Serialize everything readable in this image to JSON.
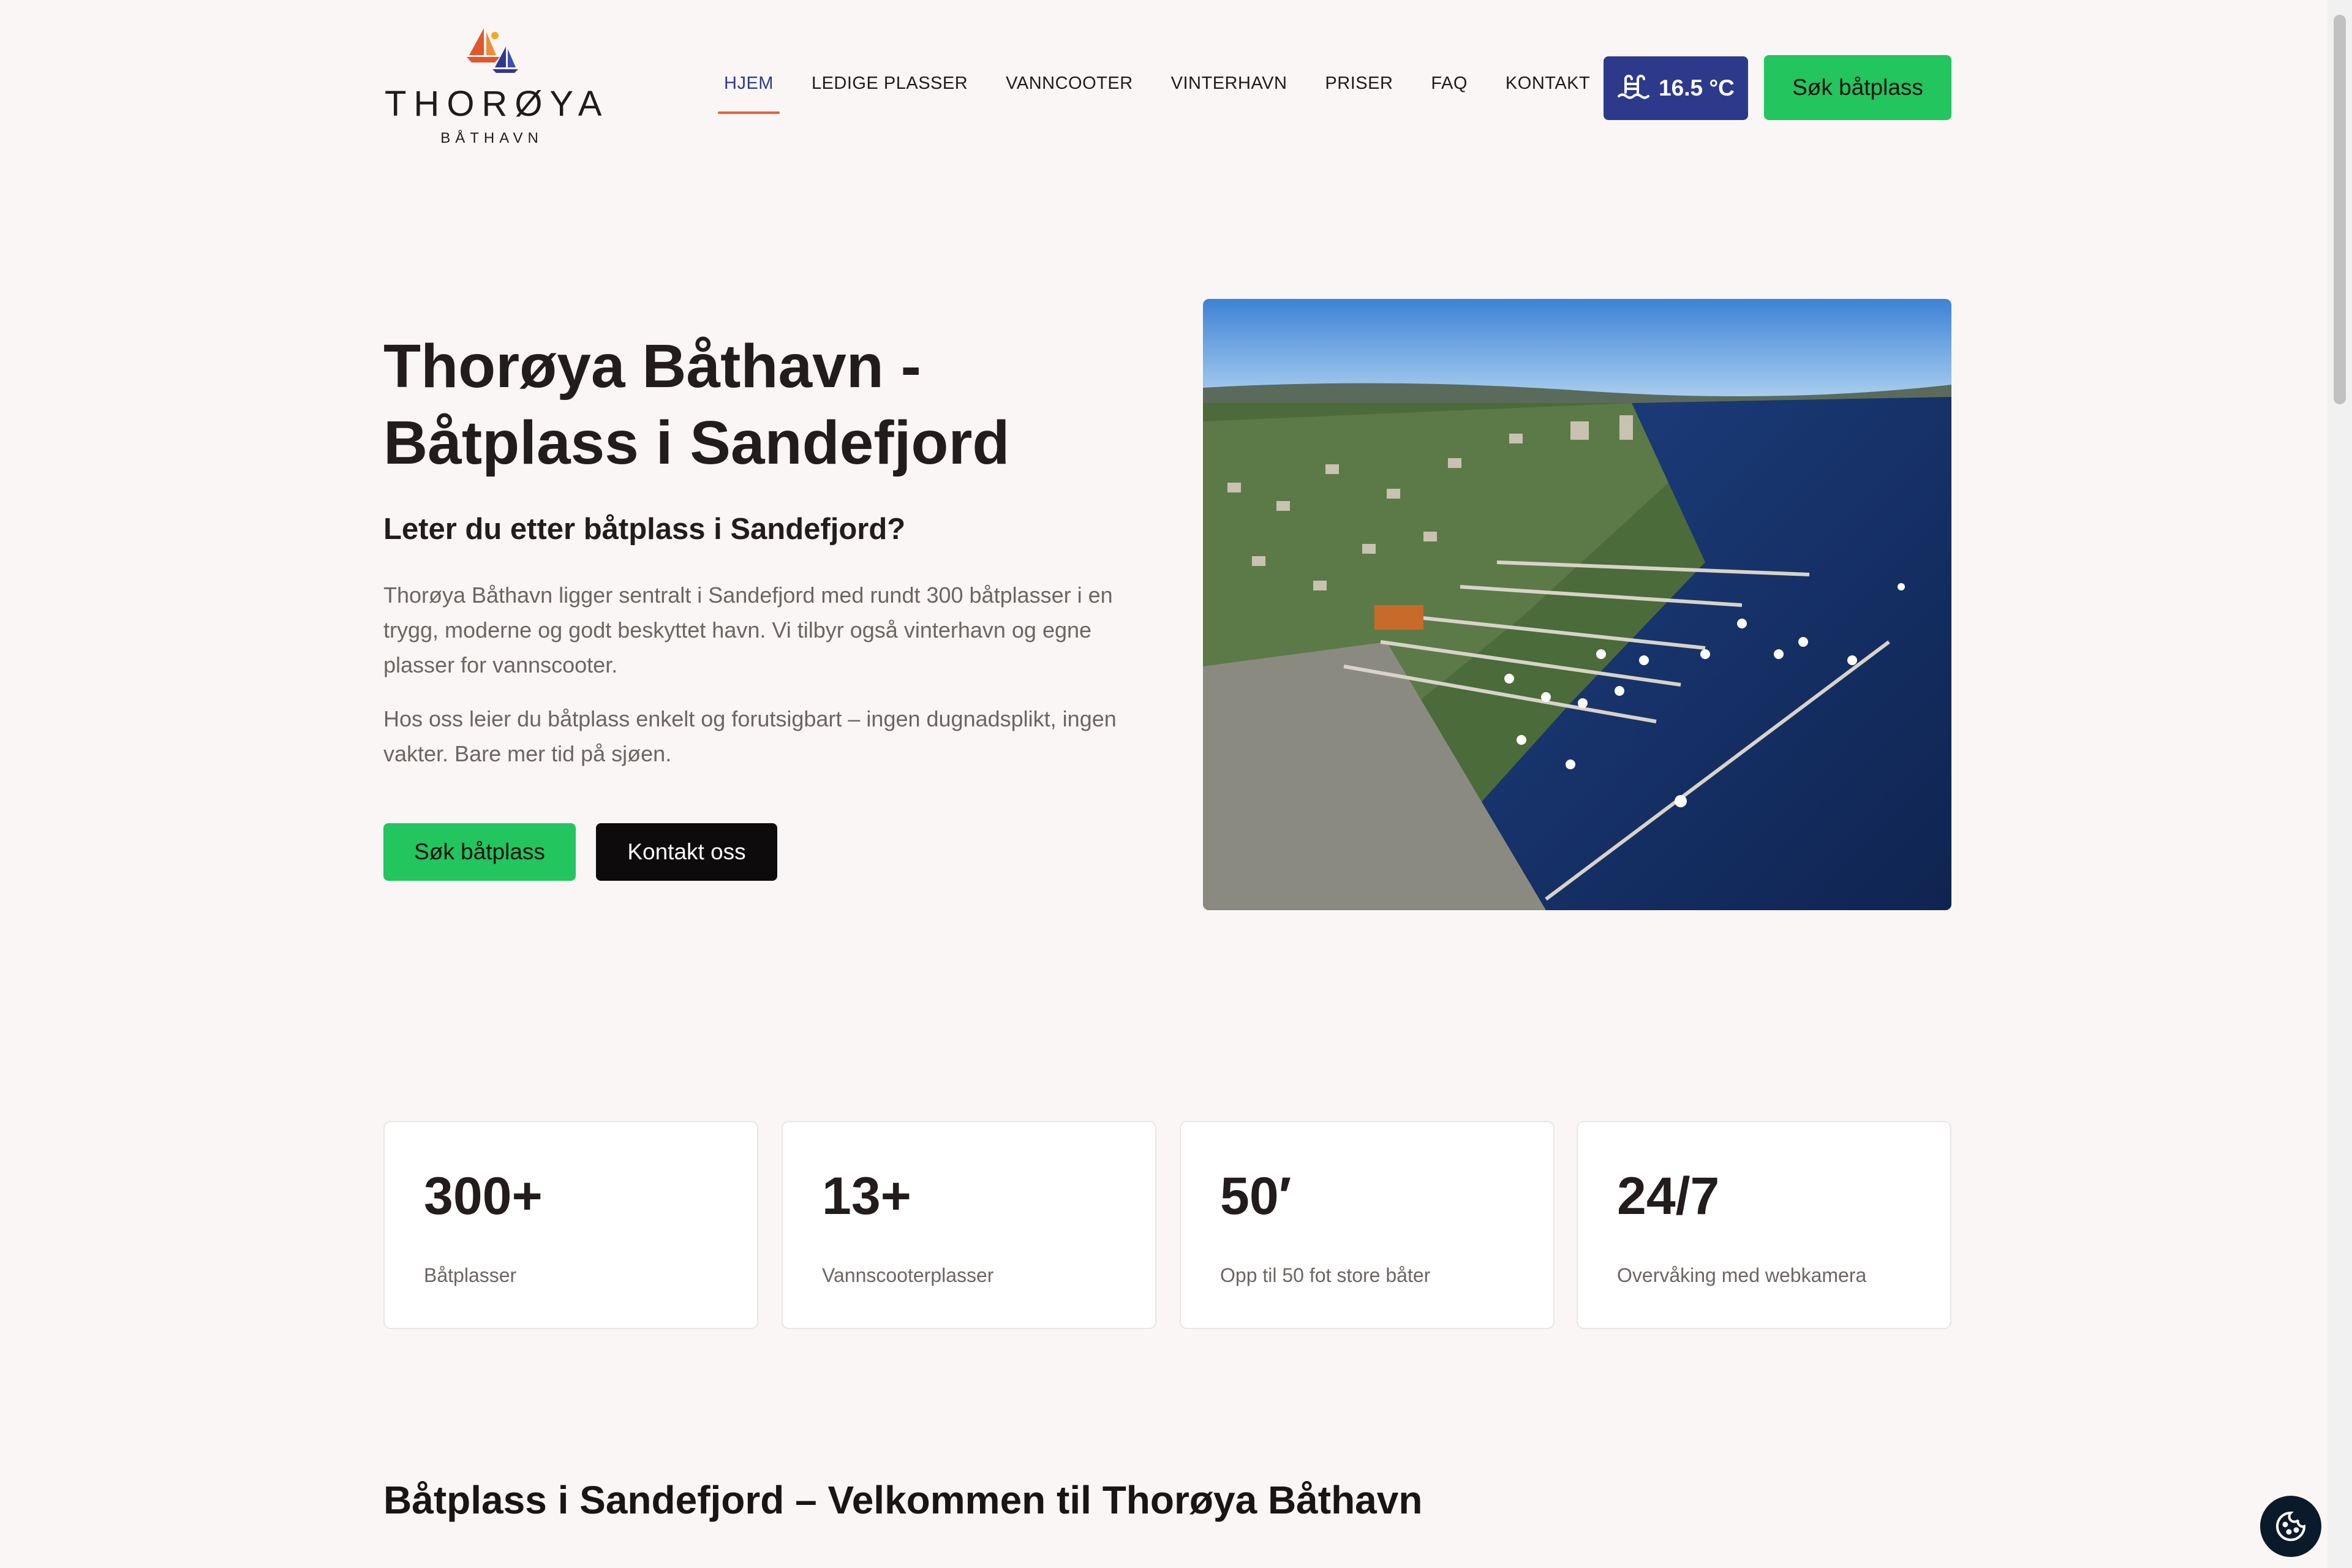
{
  "brand": {
    "name": "THORØYA",
    "subtitle": "BÅTHAVN"
  },
  "nav": {
    "items": [
      {
        "label": "HJEM",
        "active": true
      },
      {
        "label": "LEDIGE PLASSER"
      },
      {
        "label": "VANNCOOTER"
      },
      {
        "label": "VINTERHAVN"
      },
      {
        "label": "PRISER"
      },
      {
        "label": "FAQ"
      },
      {
        "label": "KONTAKT"
      }
    ]
  },
  "header": {
    "temperature": "16.5 °C",
    "temperature_icon": "swimming-water-icon",
    "cta_label": "Søk båtplass"
  },
  "hero": {
    "title_line1": "Thorøya Båthavn -",
    "title_line2": "Båtplass i Sandefjord",
    "subtitle": "Leter du etter båtplass i Sandefjord?",
    "paragraph1": "Thorøya Båthavn ligger sentralt i Sandefjord med rundt 300 båtplasser i en trygg, moderne og godt beskyttet havn. Vi tilbyr også vinterhavn og egne plasser for vannscooter.",
    "paragraph2": "Hos oss leier du båtplass enkelt og forutsigbart – ingen dugnadsplikt, ingen vakter. Bare mer tid på sjøen.",
    "primary_button": "Søk båtplass",
    "secondary_button": "Kontakt oss"
  },
  "stats": [
    {
      "value": "300+",
      "label": "Båtplasser"
    },
    {
      "value": "13+",
      "label": "Vannscooterplasser"
    },
    {
      "value": "50′",
      "label": "Opp til 50 fot store båter"
    },
    {
      "value": "24/7",
      "label": "Overvåking med webkamera"
    }
  ],
  "section": {
    "title": "Båtplass i Sandefjord – Velkommen til Thorøya Båthavn"
  },
  "colors": {
    "accent_green": "#22c55e",
    "nav_active": "#2f3a8f",
    "nav_underline": "#e7623a",
    "temp_badge": "#2d3a8c",
    "background": "#f9f6f5"
  }
}
